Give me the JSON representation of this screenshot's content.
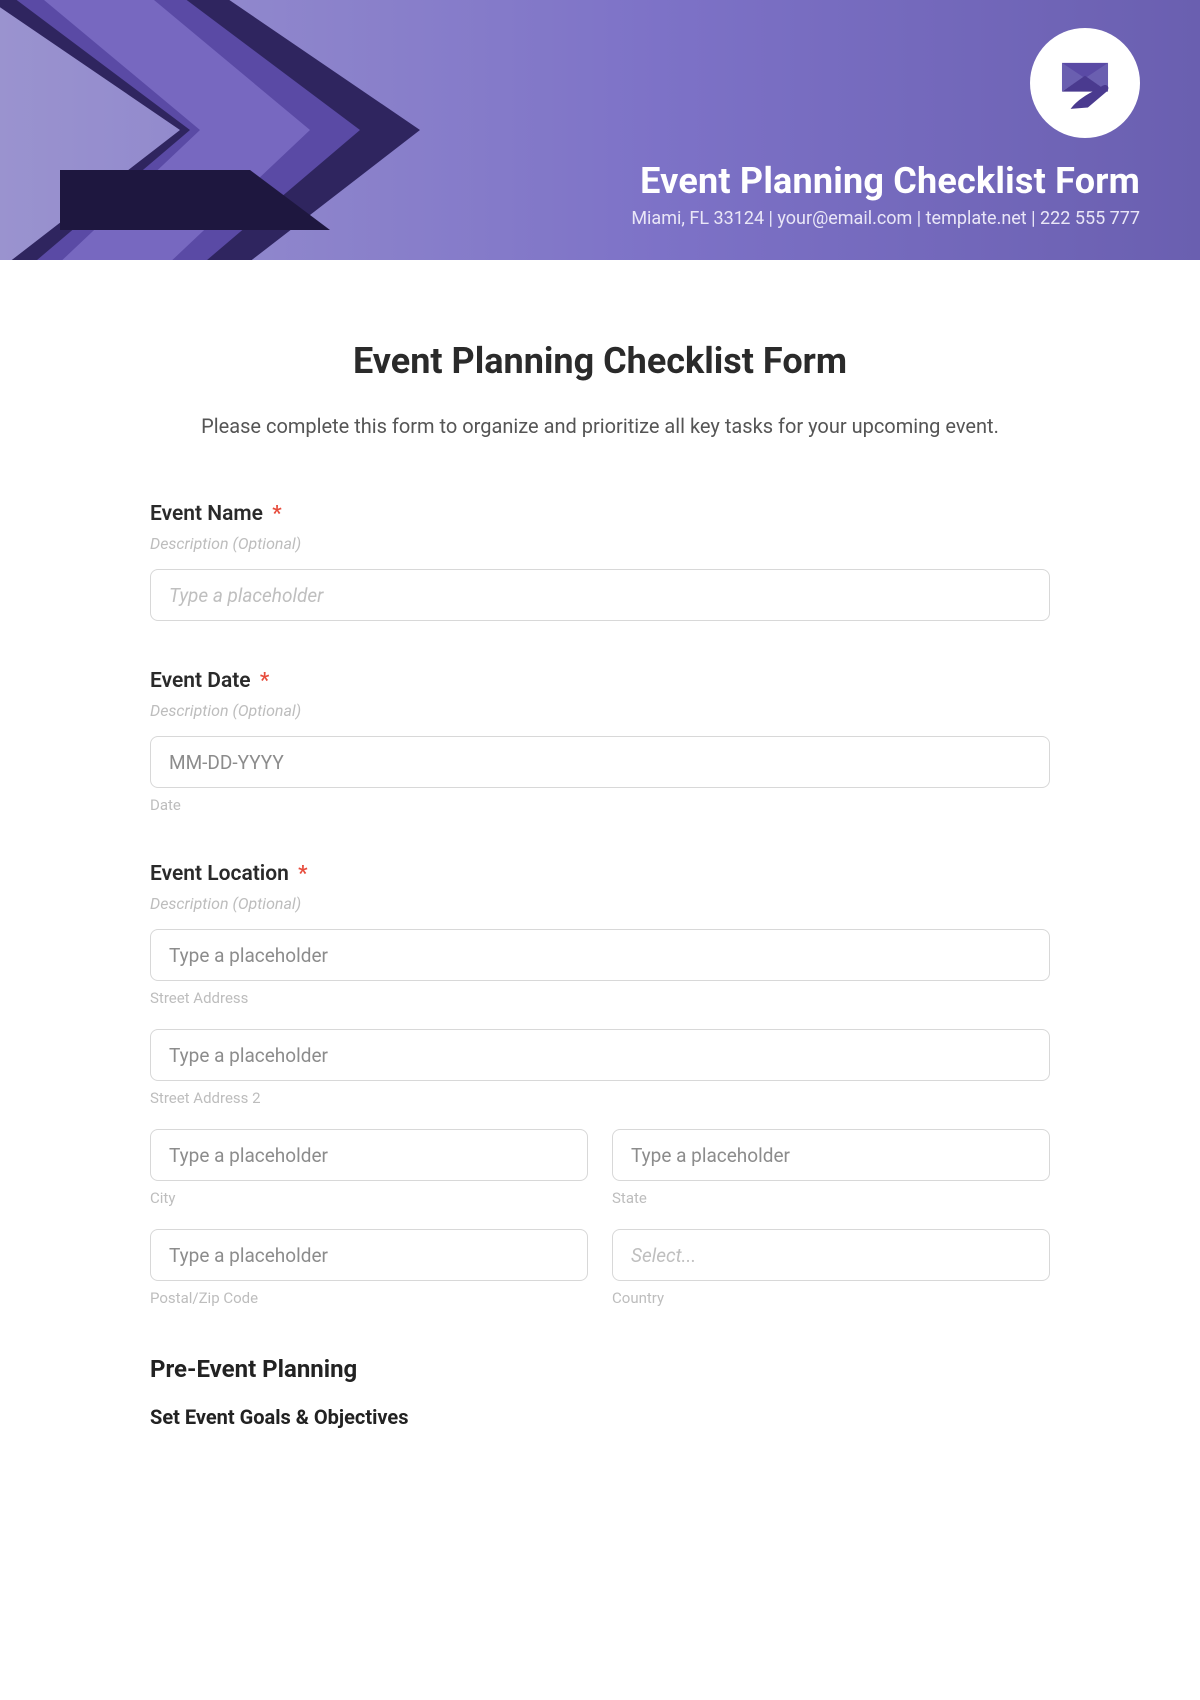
{
  "banner": {
    "title": "Event Planning Checklist Form",
    "subtitle": "Miami, FL 33124 | your@email.com | template.net | 222 555 777",
    "logo_name": "envelope-hand-icon"
  },
  "form": {
    "title": "Event Planning Checklist Form",
    "description": "Please complete this form to organize and prioritize all key tasks for your upcoming event.",
    "required_mark": "*",
    "placeholders": {
      "generic": "Type a placeholder",
      "select": "Select..."
    },
    "fields": {
      "event_name": {
        "label": "Event Name",
        "hint": "Description (Optional)"
      },
      "event_date": {
        "label": "Event Date",
        "hint": "Description (Optional)",
        "placeholder": "MM-DD-YYYY",
        "sublabel": "Date"
      },
      "event_location": {
        "label": "Event Location",
        "hint": "Description (Optional)",
        "street": "Street Address",
        "street2": "Street Address 2",
        "city": "City",
        "state": "State",
        "postal": "Postal/Zip Code",
        "country": "Country"
      }
    },
    "sections": {
      "pre_event": {
        "heading": "Pre-Event Planning",
        "sub1": "Set Event Goals & Objectives"
      }
    }
  },
  "colors": {
    "accent_dark": "#4a3a8f",
    "accent_mid": "#6a5fb0",
    "accent_light": "#8d87c4",
    "required": "#e74c3c"
  }
}
